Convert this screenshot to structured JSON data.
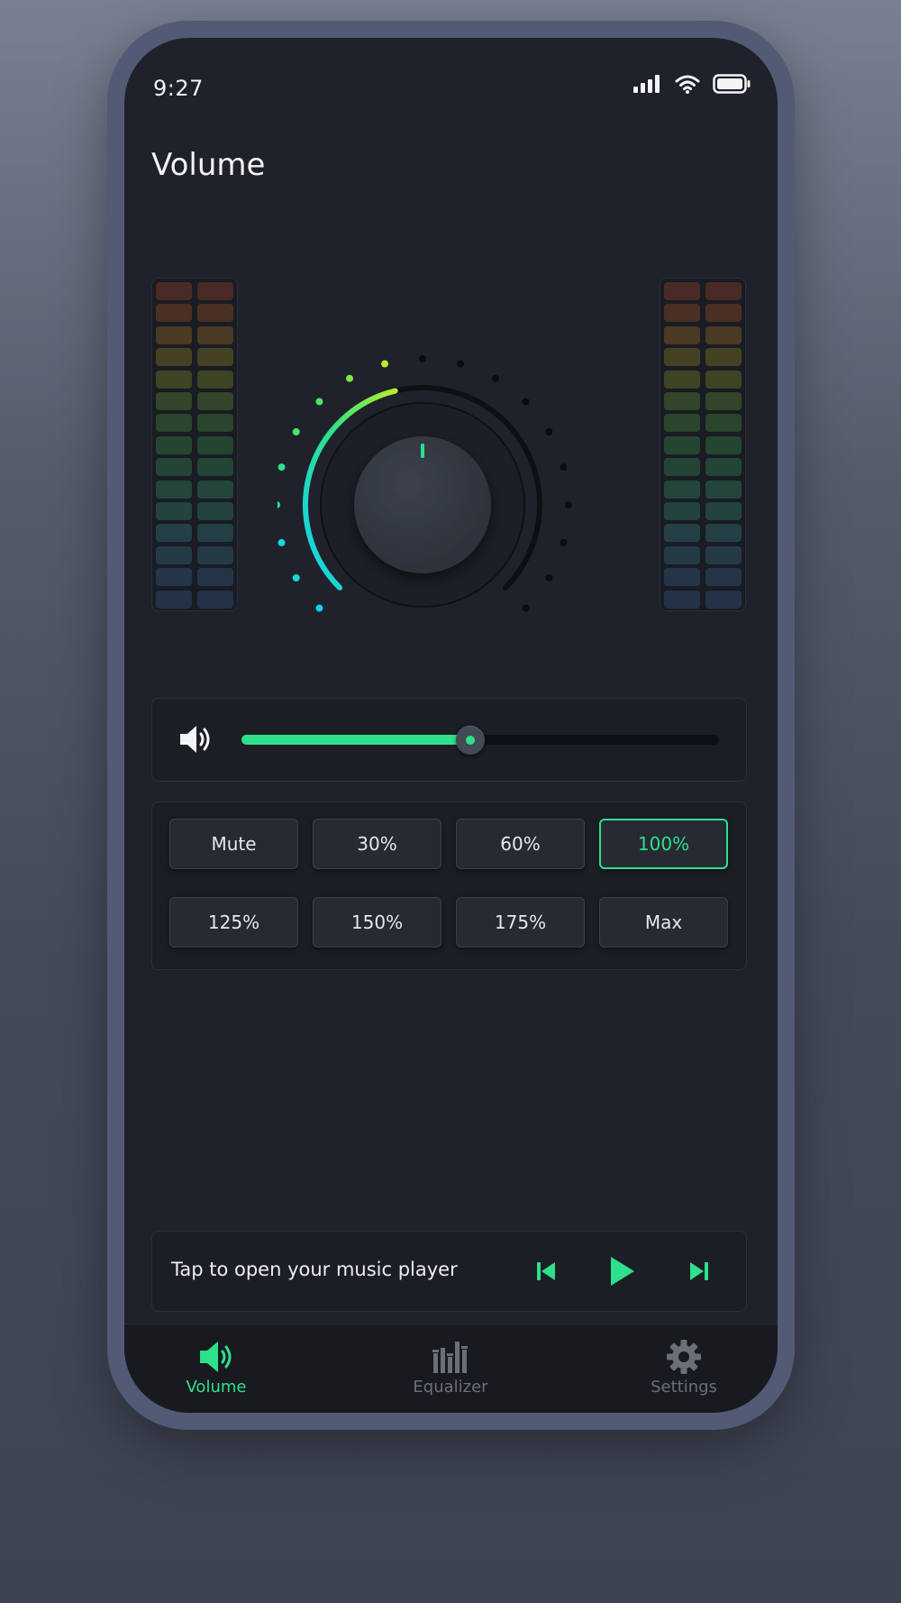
{
  "status_bar": {
    "time": "9:27"
  },
  "page": {
    "title": "Volume"
  },
  "knob": {
    "level_fraction": 0.45
  },
  "volume_slider": {
    "value_fraction": 0.48
  },
  "presets": [
    {
      "label": "Mute",
      "active": false
    },
    {
      "label": "30%",
      "active": false
    },
    {
      "label": "60%",
      "active": false
    },
    {
      "label": "100%",
      "active": true
    },
    {
      "label": "125%",
      "active": false
    },
    {
      "label": "150%",
      "active": false
    },
    {
      "label": "175%",
      "active": false
    },
    {
      "label": "Max",
      "active": false
    }
  ],
  "player": {
    "prompt": "Tap to open your music player"
  },
  "tabs": [
    {
      "label": "Volume",
      "icon": "speaker-icon",
      "active": true
    },
    {
      "label": "Equalizer",
      "icon": "equalizer-icon",
      "active": false
    },
    {
      "label": "Settings",
      "icon": "gear-icon",
      "active": false
    }
  ],
  "colors": {
    "accent": "#2ee08c",
    "screen_bg": "#1f222b",
    "phone_frame": "#525a75",
    "inactive_tab": "#6b6f78"
  }
}
